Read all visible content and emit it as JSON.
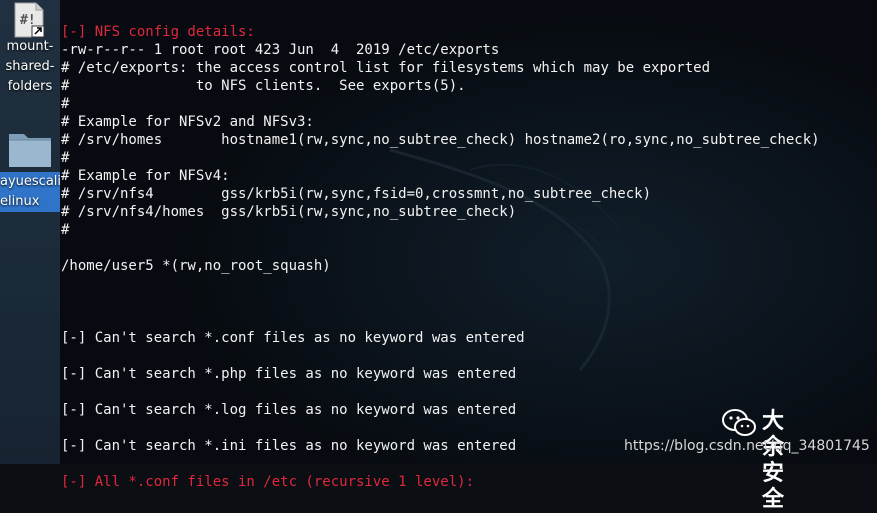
{
  "desktop": {
    "items": [
      {
        "label_lines": [
          "mount-",
          "shared-",
          "folders"
        ],
        "icon": "shell-script-icon"
      },
      {
        "label_lines": [
          "ayuescali",
          "elinux"
        ],
        "icon": "folder-icon"
      }
    ]
  },
  "terminal": {
    "lines": [
      {
        "text": "[-] NFS config details:",
        "color": "red"
      },
      {
        "text": "-rw-r--r-- 1 root root 423 Jun  4  2019 /etc/exports"
      },
      {
        "text": "# /etc/exports: the access control list for filesystems which may be exported"
      },
      {
        "text": "#               to NFS clients.  See exports(5)."
      },
      {
        "text": "#"
      },
      {
        "text": "# Example for NFSv2 and NFSv3:"
      },
      {
        "text": "# /srv/homes       hostname1(rw,sync,no_subtree_check) hostname2(ro,sync,no_subtree_check)"
      },
      {
        "text": "#"
      },
      {
        "text": "# Example for NFSv4:"
      },
      {
        "text": "# /srv/nfs4        gss/krb5i(rw,sync,fsid=0,crossmnt,no_subtree_check)"
      },
      {
        "text": "# /srv/nfs4/homes  gss/krb5i(rw,sync,no_subtree_check)"
      },
      {
        "text": "#"
      },
      {
        "text": ""
      },
      {
        "text": "/home/user5 *(rw,no_root_squash)"
      },
      {
        "text": ""
      },
      {
        "text": ""
      },
      {
        "text": ""
      },
      {
        "text": "[-] Can't search *.conf files as no keyword was entered"
      },
      {
        "text": ""
      },
      {
        "text": "[-] Can't search *.php files as no keyword was entered"
      },
      {
        "text": ""
      },
      {
        "text": "[-] Can't search *.log files as no keyword was entered"
      },
      {
        "text": ""
      },
      {
        "text": "[-] Can't search *.ini files as no keyword was entered"
      },
      {
        "text": ""
      },
      {
        "text": "[-] All *.conf files in /etc (recursive 1 level):",
        "color": "red"
      }
    ]
  },
  "watermark": {
    "brand": "大余安全",
    "url": "https://blog.csdn.net/qq_34801745"
  },
  "colors": {
    "red": "#e0283d",
    "text": "#f2f2f2",
    "selection": "#2f74c9"
  }
}
